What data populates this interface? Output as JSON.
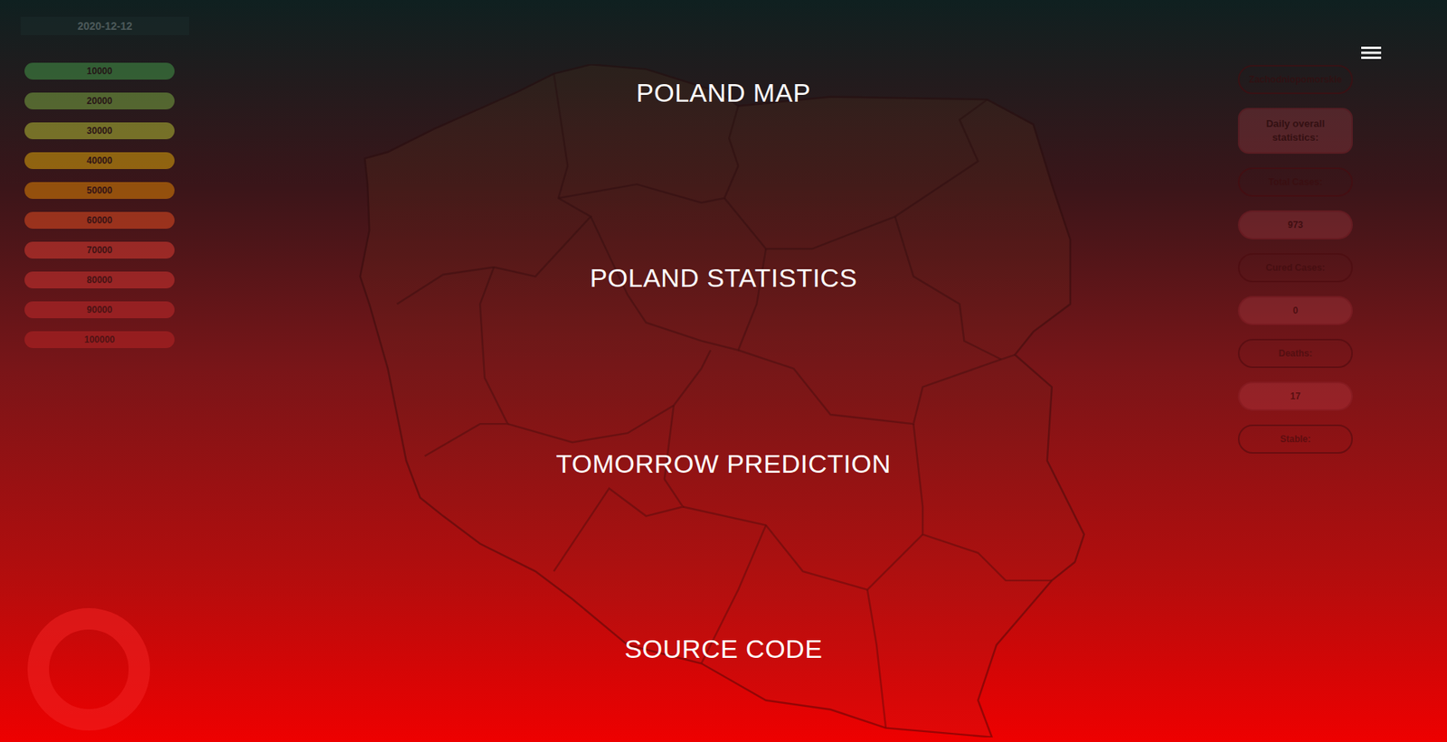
{
  "date": "2020-12-12",
  "legend": [
    {
      "label": "10000",
      "color": "#4caf50"
    },
    {
      "label": "20000",
      "color": "#8bc34a"
    },
    {
      "label": "30000",
      "color": "#cddc39"
    },
    {
      "label": "40000",
      "color": "#ffc107"
    },
    {
      "label": "50000",
      "color": "#ff9800"
    },
    {
      "label": "60000",
      "color": "#ff5722"
    },
    {
      "label": "70000",
      "color": "#f44336"
    },
    {
      "label": "80000",
      "color": "#e53935"
    },
    {
      "label": "90000",
      "color": "#d32f2f"
    },
    {
      "label": "100000",
      "color": "#c62828"
    }
  ],
  "region": {
    "name": "Zachodniopomorskie",
    "heading": "Daily overall statistics:",
    "stats": [
      {
        "label": "Total Cases:",
        "value": "973"
      },
      {
        "label": "Cured Cases:",
        "value": "0"
      },
      {
        "label": "Deaths:",
        "value": "17"
      }
    ],
    "extra": "Stable:"
  },
  "menu": {
    "open": true,
    "items": [
      "POLAND MAP",
      "POLAND STATISTICS",
      "TOMORROW PREDICTION",
      "SOURCE CODE"
    ]
  }
}
